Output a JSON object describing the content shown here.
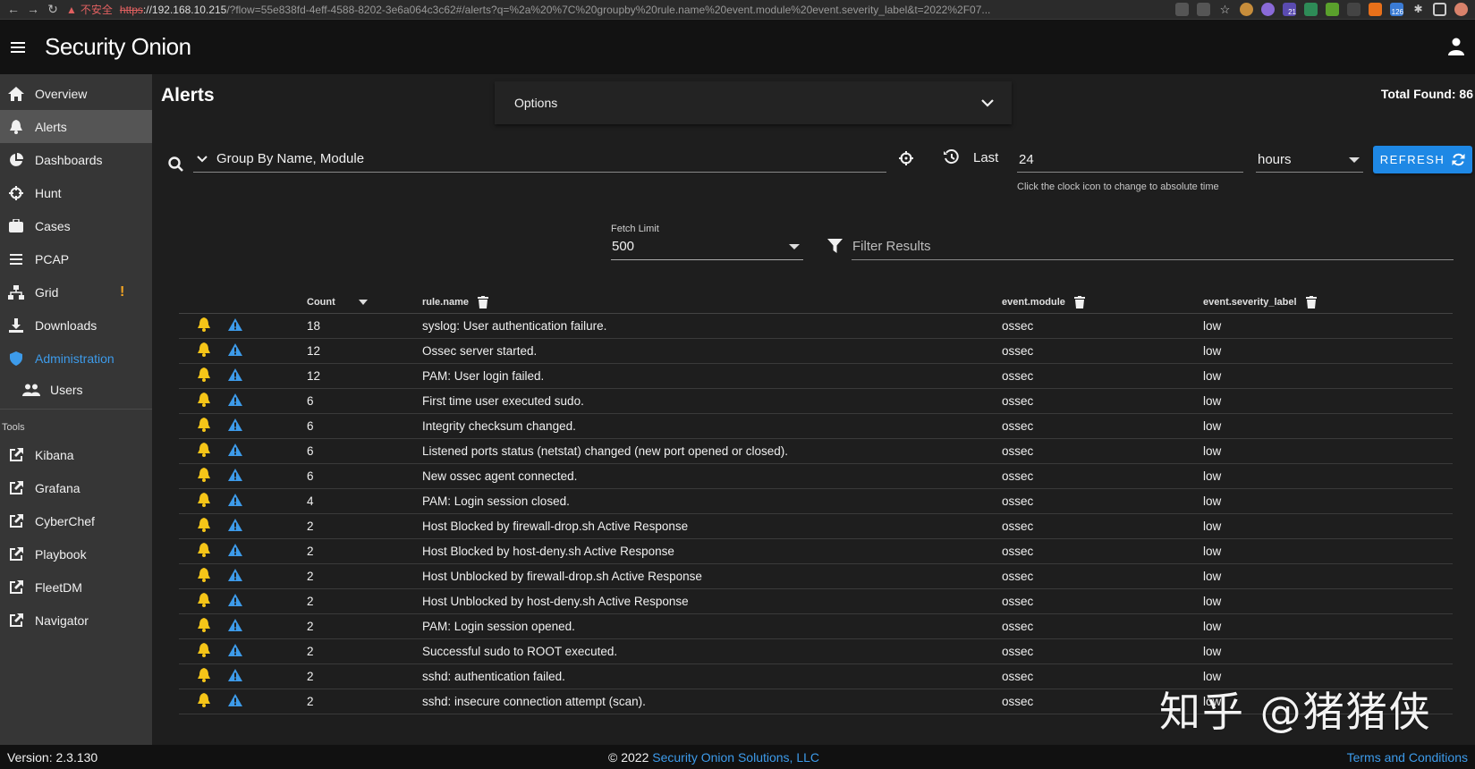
{
  "browser": {
    "insecure_label": "不安全",
    "url_scheme": "https",
    "url_host": "://192.168.10.215",
    "url_rest": "/?flow=55e838fd-4eff-4588-8202-3e6a064c3c62#/alerts?q=%2a%20%7C%20groupby%20rule.name%20event.module%20event.severity_label&t=2022%2F07...",
    "ext_badge_1": "21",
    "ext_badge_2": "126"
  },
  "app": {
    "brand": "Security Onion",
    "page_title": "Alerts",
    "options_label": "Options",
    "total_found": "Total Found: 86"
  },
  "sidebar": {
    "items": [
      {
        "label": "Overview",
        "icon": "home-icon"
      },
      {
        "label": "Alerts",
        "icon": "bell-icon"
      },
      {
        "label": "Dashboards",
        "icon": "pie-chart-icon"
      },
      {
        "label": "Hunt",
        "icon": "crosshair-icon"
      },
      {
        "label": "Cases",
        "icon": "briefcase-icon"
      },
      {
        "label": "PCAP",
        "icon": "list-icon"
      },
      {
        "label": "Grid",
        "icon": "sitemap-icon",
        "badge": "!"
      },
      {
        "label": "Downloads",
        "icon": "download-icon"
      },
      {
        "label": "Administration",
        "icon": "shield-icon"
      },
      {
        "label": "Users",
        "icon": "users-icon"
      }
    ],
    "tools_label": "Tools",
    "tools": [
      {
        "label": "Kibana",
        "icon": "external-link-icon"
      },
      {
        "label": "Grafana",
        "icon": "external-link-icon"
      },
      {
        "label": "CyberChef",
        "icon": "external-link-icon"
      },
      {
        "label": "Playbook",
        "icon": "external-link-icon"
      },
      {
        "label": "FleetDM",
        "icon": "external-link-icon"
      },
      {
        "label": "Navigator",
        "icon": "external-link-icon"
      }
    ]
  },
  "query": {
    "value": "Group By Name, Module",
    "last_label": "Last",
    "time_value": "24",
    "time_hint": "Click the clock icon to change to absolute time",
    "unit": "hours",
    "refresh_label": "REFRESH",
    "fetch_limit_label": "Fetch Limit",
    "fetch_limit_value": "500",
    "filter_placeholder": "Filter Results"
  },
  "table": {
    "headers": {
      "count": "Count",
      "rule": "rule.name",
      "module": "event.module",
      "severity": "event.severity_label"
    },
    "rows": [
      {
        "count": "18",
        "rule": "syslog: User authentication failure.",
        "module": "ossec",
        "severity": "low"
      },
      {
        "count": "12",
        "rule": "Ossec server started.",
        "module": "ossec",
        "severity": "low"
      },
      {
        "count": "12",
        "rule": "PAM: User login failed.",
        "module": "ossec",
        "severity": "low"
      },
      {
        "count": "6",
        "rule": "First time user executed sudo.",
        "module": "ossec",
        "severity": "low"
      },
      {
        "count": "6",
        "rule": "Integrity checksum changed.",
        "module": "ossec",
        "severity": "low"
      },
      {
        "count": "6",
        "rule": "Listened ports status (netstat) changed (new port opened or closed).",
        "module": "ossec",
        "severity": "low"
      },
      {
        "count": "6",
        "rule": "New ossec agent connected.",
        "module": "ossec",
        "severity": "low"
      },
      {
        "count": "4",
        "rule": "PAM: Login session closed.",
        "module": "ossec",
        "severity": "low"
      },
      {
        "count": "2",
        "rule": "Host Blocked by firewall-drop.sh Active Response",
        "module": "ossec",
        "severity": "low"
      },
      {
        "count": "2",
        "rule": "Host Blocked by host-deny.sh Active Response",
        "module": "ossec",
        "severity": "low"
      },
      {
        "count": "2",
        "rule": "Host Unblocked by firewall-drop.sh Active Response",
        "module": "ossec",
        "severity": "low"
      },
      {
        "count": "2",
        "rule": "Host Unblocked by host-deny.sh Active Response",
        "module": "ossec",
        "severity": "low"
      },
      {
        "count": "2",
        "rule": "PAM: Login session opened.",
        "module": "ossec",
        "severity": "low"
      },
      {
        "count": "2",
        "rule": "Successful sudo to ROOT executed.",
        "module": "ossec",
        "severity": "low"
      },
      {
        "count": "2",
        "rule": "sshd: authentication failed.",
        "module": "ossec",
        "severity": "low"
      },
      {
        "count": "2",
        "rule": "sshd: insecure connection attempt (scan).",
        "module": "ossec",
        "severity": "low"
      }
    ]
  },
  "footer": {
    "version": "Version: 2.3.130",
    "copyright": "© 2022",
    "company": "Security Onion Solutions, LLC",
    "terms": "Terms and Conditions"
  },
  "watermark": "知乎 @猪猪侠",
  "colors": {
    "accent": "#1e88e5",
    "link": "#3d9bea",
    "bell": "#f5c518",
    "warn_triangle": "#3d9bea",
    "grid_badge": "#f5a623"
  }
}
